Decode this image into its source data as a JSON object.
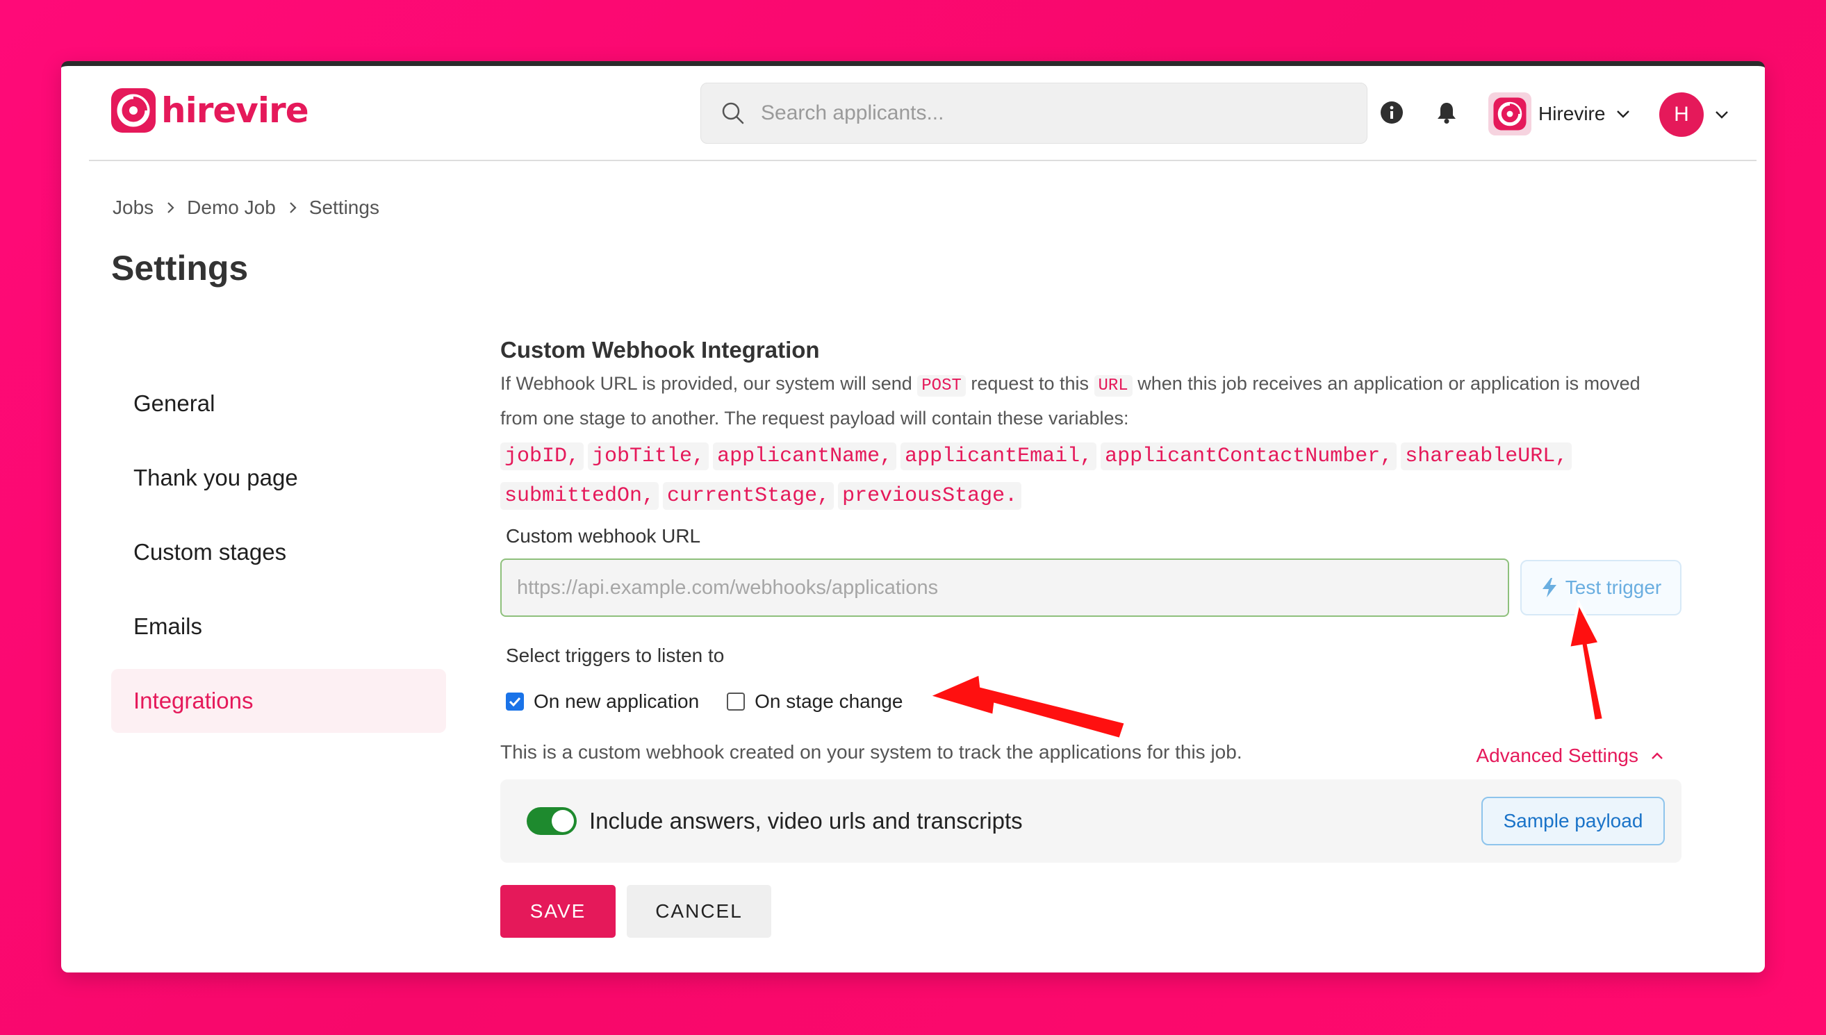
{
  "brand": {
    "name": "hirevire",
    "accent": "#e5195a",
    "background": "#ff0a78"
  },
  "header": {
    "search_placeholder": "Search applicants...",
    "info_icon": "info-icon",
    "notification_icon": "bell-icon",
    "org_name": "Hirevire",
    "user_initial": "H"
  },
  "breadcrumb": [
    "Jobs",
    "Demo Job",
    "Settings"
  ],
  "page_title": "Settings",
  "sidebar": {
    "items": [
      {
        "label": "General",
        "active": false
      },
      {
        "label": "Thank you page",
        "active": false
      },
      {
        "label": "Custom stages",
        "active": false
      },
      {
        "label": "Emails",
        "active": false
      },
      {
        "label": "Integrations",
        "active": true
      }
    ]
  },
  "webhook": {
    "title": "Custom Webhook Integration",
    "desc_part1": "If Webhook URL is provided, our system will send",
    "desc_method": "POST",
    "desc_part2": "request to this",
    "desc_url": "URL",
    "desc_part3": "when this job receives an application or application is moved from one stage to another. The request payload will contain these variables:",
    "variables": [
      "jobID,",
      "jobTitle,",
      "applicantName,",
      "applicantEmail,",
      "applicantContactNumber,",
      "shareableURL,",
      "submittedOn,",
      "currentStage,",
      "previousStage."
    ],
    "url_label": "Custom webhook URL",
    "url_placeholder": "https://api.example.com/webhooks/applications",
    "url_value": "",
    "test_trigger_label": "Test trigger",
    "triggers_label": "Select triggers to listen to",
    "triggers": [
      {
        "label": "On new application",
        "checked": true
      },
      {
        "label": "On stage change",
        "checked": false
      }
    ],
    "help_text": "This is a custom webhook created on your system to track the applications for this job.",
    "advanced_label": "Advanced Settings",
    "include_toggle_label": "Include answers, video urls and transcripts",
    "include_toggle_on": true,
    "sample_payload_label": "Sample payload"
  },
  "actions": {
    "save_label": "SAVE",
    "cancel_label": "CANCEL"
  }
}
